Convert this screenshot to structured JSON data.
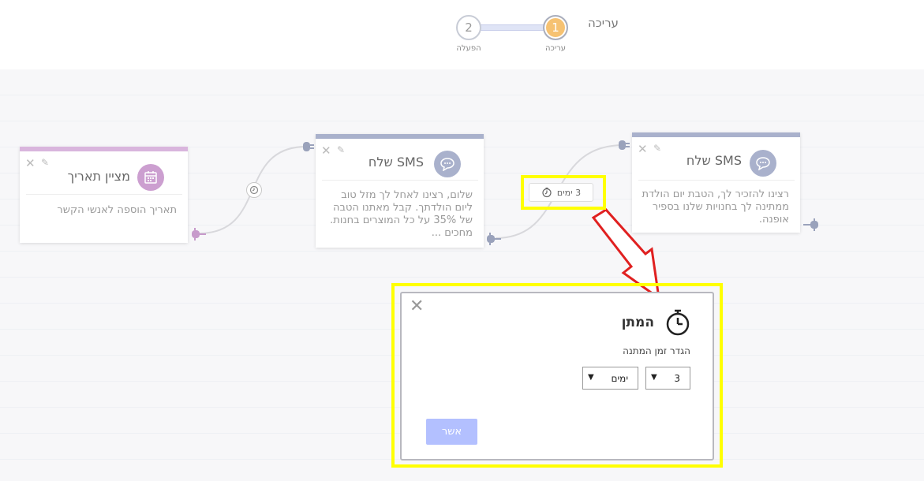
{
  "header": {
    "title": "עריכה",
    "steps": [
      {
        "number": "1",
        "label": "עריכה",
        "active": true
      },
      {
        "number": "2",
        "label": "הפעלה",
        "active": false
      }
    ]
  },
  "nodes": [
    {
      "title": "מציין תאריך",
      "body": "תאריך הוספה לאנשי הקשר",
      "icon": "calendar-icon",
      "color": "#cc9fd0"
    },
    {
      "title": "שלח SMS",
      "body": "שלום, רצינו לאחל לך מזל טוב ליום הולדתך. קבל מאתנו הטבה של 35% על כל המוצרים בחנות. מחכים ...",
      "icon": "chat-icon",
      "color": "#a9b1cc"
    },
    {
      "title": "שלח SMS",
      "body": "רצינו להזכיר לך, הטבת יום הולדת ממתינה לך בחנויות שלנו בספיר אופנה.",
      "icon": "chat-icon",
      "color": "#a9b1cc"
    }
  ],
  "wait_chip": {
    "label": "3 ימים"
  },
  "dialog": {
    "title": "המתן",
    "subtitle": "הגדר זמן המתנה",
    "amount_value": "3",
    "unit_value": "ימים",
    "confirm_label": "אשר"
  },
  "colors": {
    "highlight": "#ffff00",
    "arrow": "#e02020",
    "button": "#b3c0ff",
    "step_active": "#f6c272"
  }
}
